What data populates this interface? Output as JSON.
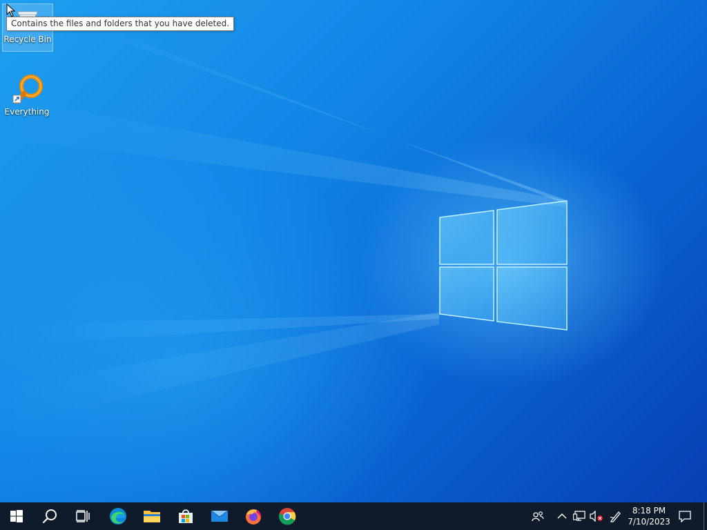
{
  "desktop": {
    "icons": [
      {
        "label": "Recycle Bin",
        "icon": "recycle-bin-icon"
      },
      {
        "label": "Everything",
        "icon": "everything-search-icon"
      }
    ],
    "tooltip": "Contains the files and folders that you have deleted."
  },
  "taskbar": {
    "buttons": [
      {
        "name": "start",
        "icon": "windows-logo-icon"
      },
      {
        "name": "search",
        "icon": "search-icon"
      },
      {
        "name": "task-view",
        "icon": "task-view-icon"
      },
      {
        "name": "edge",
        "icon": "edge-icon"
      },
      {
        "name": "file-explorer",
        "icon": "folder-icon"
      },
      {
        "name": "microsoft-store",
        "icon": "store-icon"
      },
      {
        "name": "mail",
        "icon": "mail-icon"
      },
      {
        "name": "firefox",
        "icon": "firefox-icon"
      },
      {
        "name": "chrome",
        "icon": "chrome-icon"
      }
    ],
    "tray": {
      "icons": [
        "people-icon",
        "chevron-up-icon",
        "network-icon",
        "volume-muted-icon",
        "pen-icon"
      ],
      "time": "8:18 PM",
      "date": "7/10/2023",
      "notification_icon": "action-center-icon"
    }
  },
  "colors": {
    "taskbar_bg": "#0f1a2b",
    "wallpaper_light": "#1f9ff0",
    "wallpaper_dark": "#073fb0"
  }
}
